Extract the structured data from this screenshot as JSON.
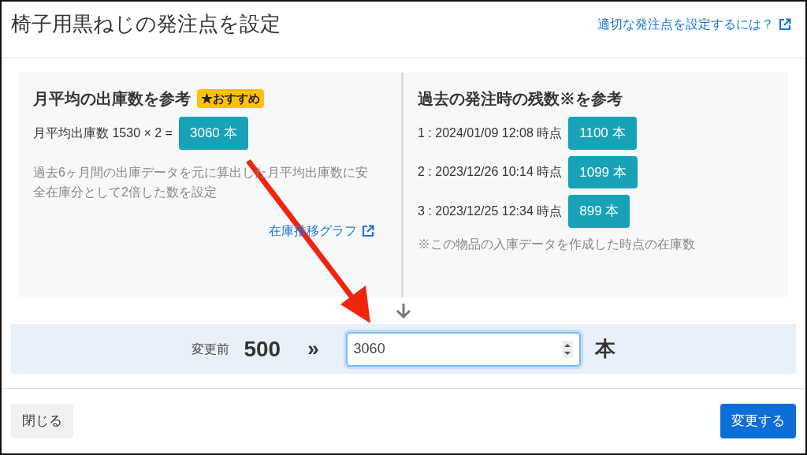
{
  "modal": {
    "title": "椅子用黒ねじの発注点を設定",
    "help_link": "適切な発注点を設定するには？"
  },
  "monthly_panel": {
    "title": "月平均の出庫数を参考",
    "badge": "★おすすめ",
    "formula": "月平均出庫数 1530 × 2 =",
    "result": "3060 本",
    "description": "過去6ヶ月間の出庫データを元に算出した月平均出庫数に安全在庫分として2倍した数を設定",
    "link": "在庫推移グラフ"
  },
  "history_panel": {
    "title": "過去の発注時の残数※を参考",
    "entries": [
      {
        "label": "1 : 2024/01/09 12:08 時点",
        "value": "1100 本"
      },
      {
        "label": "2 : 2023/12/26 10:14 時点",
        "value": "1099 本"
      },
      {
        "label": "3 : 2023/12/25 12:34 時点",
        "value": "899 本"
      }
    ],
    "note": "※この物品の入庫データを作成した時点の在庫数"
  },
  "change": {
    "before_label": "変更前",
    "before_value": "500",
    "arrow": "»",
    "input_value": "3060",
    "unit": "本"
  },
  "buttons": {
    "close": "閉じる",
    "submit": "変更する"
  }
}
